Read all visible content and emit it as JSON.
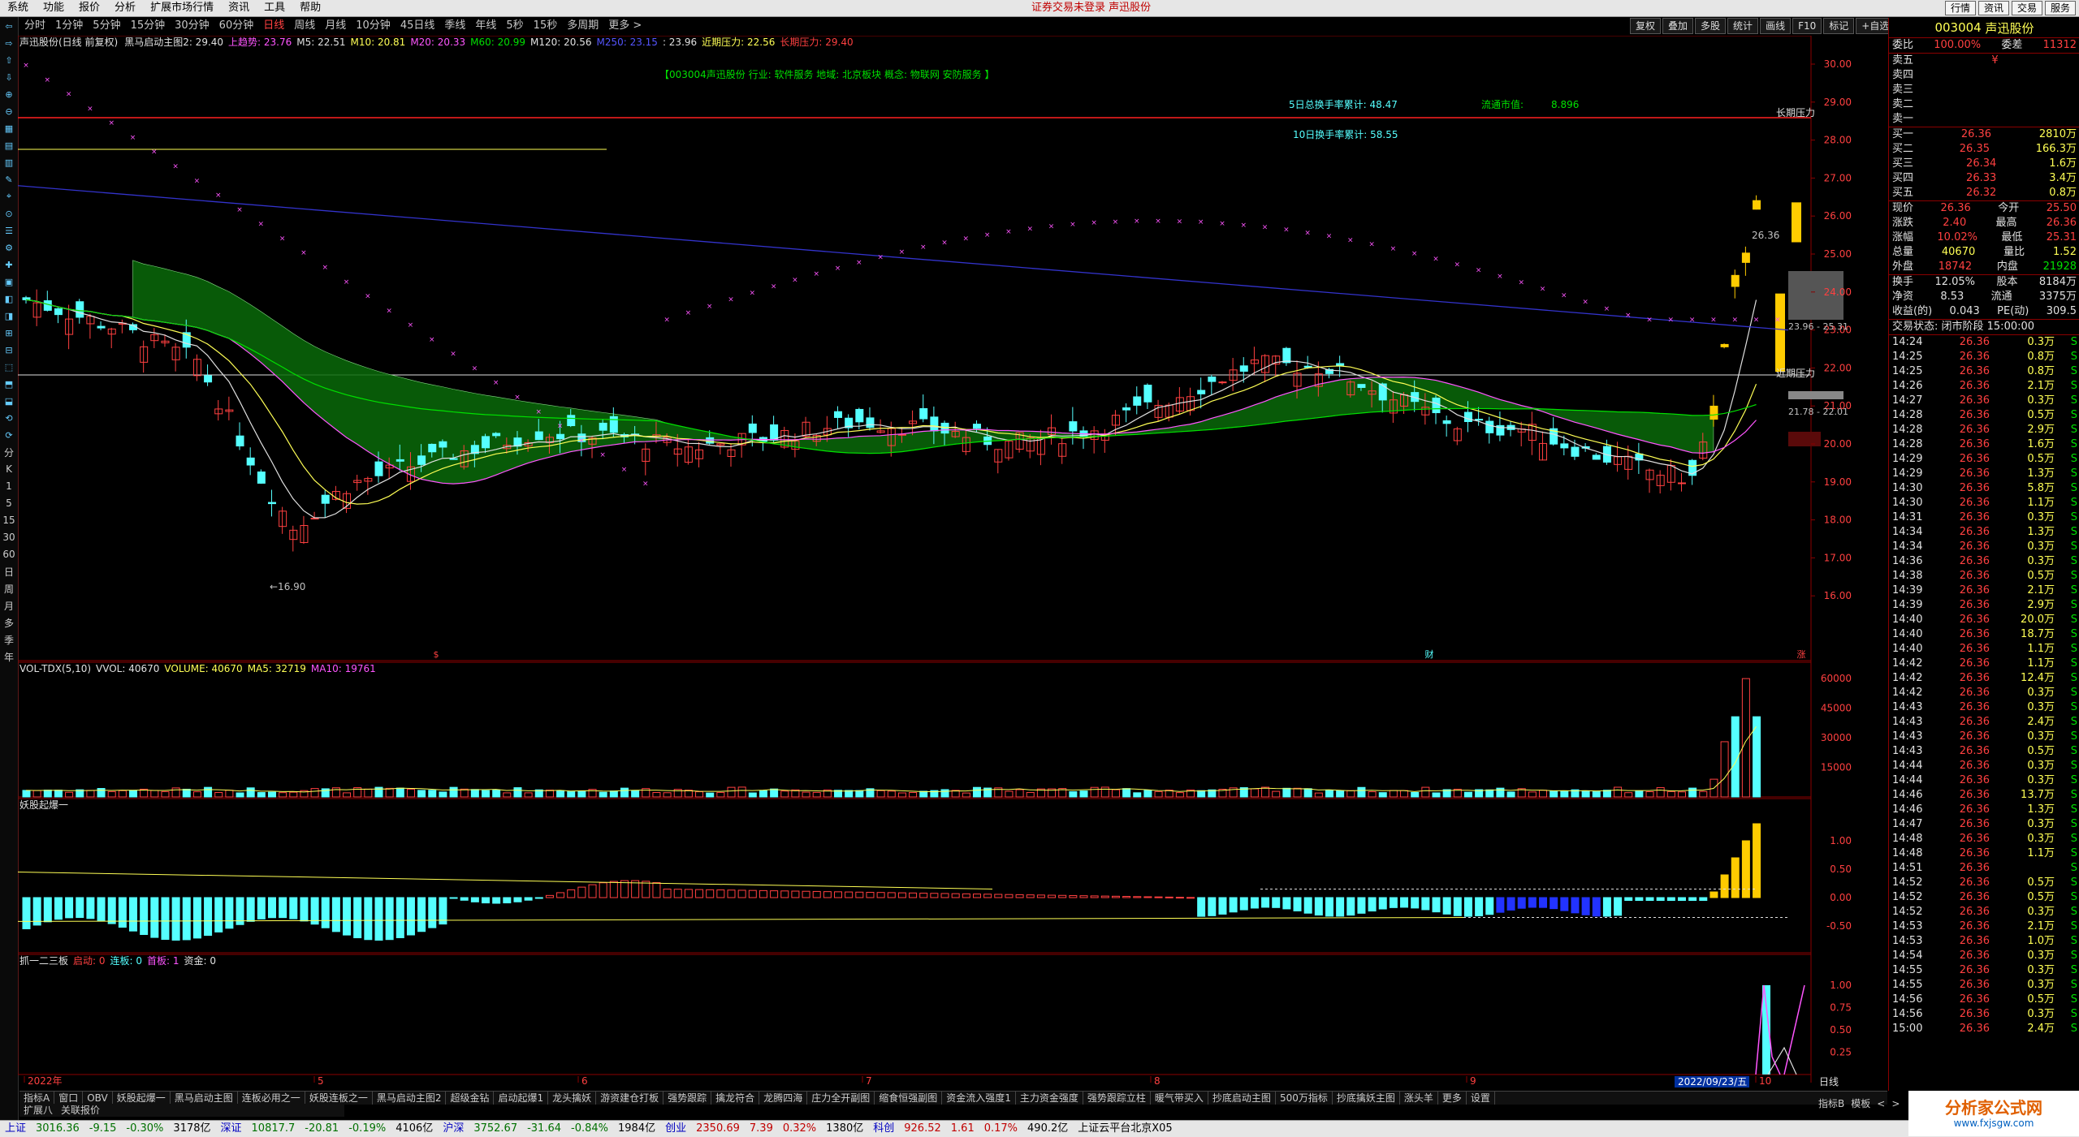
{
  "menubar": {
    "items": [
      "系统",
      "功能",
      "报价",
      "分析",
      "扩展市场行情",
      "资讯",
      "工具",
      "帮助"
    ],
    "center_text": "证券交易未登录 声迅股份",
    "right_buttons": [
      "行情",
      "资讯",
      "交易",
      "服务"
    ]
  },
  "periods": {
    "items": [
      "分时",
      "1分钟",
      "5分钟",
      "15分钟",
      "30分钟",
      "60分钟",
      "日线",
      "周线",
      "月线",
      "10分钟",
      "45日线",
      "季线",
      "年线",
      "5秒",
      "15秒",
      "多周期",
      "更多 >"
    ],
    "active": "日线"
  },
  "chart_buttons": [
    "复权",
    "叠加",
    "多股",
    "统计",
    "画线",
    "F10",
    "标记",
    "+自选",
    "返回"
  ],
  "left_tools": [
    "分",
    "K",
    "1",
    "5",
    "15",
    "30",
    "60",
    "日",
    "周",
    "月",
    "多",
    "季",
    "年"
  ],
  "main_header": {
    "title": "声迅股份(日线 前复权)",
    "indicator": "黑马启动主图2",
    "value": ": 29.40",
    "items": [
      {
        "text": "上趋势: 23.76",
        "color": "#ff55ff"
      },
      {
        "text": "M5: 22.51",
        "color": "#e0e0e0"
      },
      {
        "text": "M10: 20.81",
        "color": "#ffff55"
      },
      {
        "text": "M20: 20.33",
        "color": "#ff55ff"
      },
      {
        "text": "M60: 20.99",
        "color": "#00e000"
      },
      {
        "text": "M120: 20.56",
        "color": "#e0e0e0"
      },
      {
        "text": "M250: 23.15",
        "color": "#5555ff"
      },
      {
        "text": ": 23.96",
        "color": "#e0e0e0"
      },
      {
        "text": "近期压力: 22.56",
        "color": "#ffff55"
      },
      {
        "text": "长期压力: 29.40",
        "color": "#ff4040"
      }
    ]
  },
  "info_banner": "【003004声迅股份  行业: 软件服务  地域: 北京板块  概念: 物联网 安防服务 】",
  "stats": {
    "turnover5_label": "5日总换手率累计: 48.47",
    "float_label": "流通市值:",
    "float_value": "8.896",
    "turnover10_label": "10日换手率累计: 58.55"
  },
  "annotations": {
    "long_pressure": "长期压力",
    "near_pressure": "近期压力",
    "low_label": "←16.90",
    "high_label": "26.36",
    "range1": "23.96 - 25.31",
    "range2": "21.78 - 22.01"
  },
  "vol_header": {
    "title": "VOL-TDX(5,10)",
    "items": [
      {
        "text": "VVOL: 40670",
        "color": "#e0e0e0"
      },
      {
        "text": "VOLUME: 40670",
        "color": "#ffff55"
      },
      {
        "text": "MA5: 32719",
        "color": "#ffff55"
      },
      {
        "text": "MA10: 19761",
        "color": "#ff55ff"
      }
    ]
  },
  "ind1_header": {
    "title": "妖股起爆一"
  },
  "ind2_header": {
    "title": "抓一二三板",
    "items": [
      {
        "text": "启动: 0",
        "color": "#ff4040"
      },
      {
        "text": "连板: 0",
        "color": "#55ffff"
      },
      {
        "text": "首板: 1",
        "color": "#ff55ff"
      },
      {
        "text": "资金: 0",
        "color": "#e0e0e0"
      }
    ]
  },
  "price_axis": [
    "30.00",
    "29.00",
    "28.00",
    "27.00",
    "26.00",
    "25.00",
    "24.00",
    "23.00",
    "22.00",
    "21.00",
    "20.00",
    "19.00",
    "18.00",
    "17.00",
    "16.00"
  ],
  "vol_axis": [
    "60000",
    "45000",
    "30000",
    "15000"
  ],
  "ind1_axis": [
    "1.00",
    "0.50",
    "0.00",
    "-0.50"
  ],
  "ind2_axis": [
    "1.00",
    "0.75",
    "0.50",
    "0.25"
  ],
  "date_axis": {
    "labels": [
      "2022年",
      "5",
      "6",
      "7",
      "8",
      "9",
      "10"
    ],
    "highlight": "2022/09/23/五",
    "right": "日线"
  },
  "markers": [
    "$",
    "财",
    "涨"
  ],
  "quote": {
    "code": "003004",
    "name": "声迅股份",
    "weibi_label": "委比",
    "weibi": "100.00%",
    "weicha_label": "委差",
    "weicha": "11312",
    "asks": [
      {
        "label": "卖五",
        "price": "¥",
        "vol": ""
      },
      {
        "label": "卖四",
        "price": "",
        "vol": ""
      },
      {
        "label": "卖三",
        "price": "",
        "vol": ""
      },
      {
        "label": "卖二",
        "price": "",
        "vol": ""
      },
      {
        "label": "卖一",
        "price": "",
        "vol": ""
      }
    ],
    "bids": [
      {
        "label": "买一",
        "price": "26.36",
        "vol": "2810万"
      },
      {
        "label": "买二",
        "price": "26.35",
        "vol": "166.3万"
      },
      {
        "label": "买三",
        "price": "26.34",
        "vol": "1.6万"
      },
      {
        "label": "买四",
        "price": "26.33",
        "vol": "3.4万"
      },
      {
        "label": "买五",
        "price": "26.32",
        "vol": "0.8万"
      }
    ],
    "stats": [
      {
        "l1": "现价",
        "v1": "26.36",
        "c1": "red",
        "l2": "今开",
        "v2": "25.50",
        "c2": "red"
      },
      {
        "l1": "涨跌",
        "v1": "2.40",
        "c1": "red",
        "l2": "最高",
        "v2": "26.36",
        "c2": "red"
      },
      {
        "l1": "涨幅",
        "v1": "10.02%",
        "c1": "red",
        "l2": "最低",
        "v2": "25.31",
        "c2": "red"
      },
      {
        "l1": "总量",
        "v1": "40670",
        "c1": "yel",
        "l2": "量比",
        "v2": "1.52",
        "c2": "yel"
      },
      {
        "l1": "外盘",
        "v1": "18742",
        "c1": "red",
        "l2": "内盘",
        "v2": "21928",
        "c2": "grn"
      }
    ],
    "stats2": [
      {
        "l1": "换手",
        "v1": "12.05%",
        "c1": "wht",
        "l2": "股本",
        "v2": "8184万",
        "c2": "wht"
      },
      {
        "l1": "净资",
        "v1": "8.53",
        "c1": "wht",
        "l2": "流通",
        "v2": "3375万",
        "c2": "wht"
      },
      {
        "l1": "收益(的)",
        "v1": "0.043",
        "c1": "wht",
        "l2": "PE(动)",
        "v2": "309.5",
        "c2": "wht"
      }
    ],
    "trade_status": "交易状态: 闭市阶段 15:00:00",
    "ticks": [
      [
        "14:24",
        "26.36",
        "0.3万",
        "S"
      ],
      [
        "14:25",
        "26.36",
        "0.8万",
        "S"
      ],
      [
        "14:25",
        "26.36",
        "0.8万",
        "S"
      ],
      [
        "14:26",
        "26.36",
        "2.1万",
        "S"
      ],
      [
        "14:27",
        "26.36",
        "0.3万",
        "S"
      ],
      [
        "14:28",
        "26.36",
        "0.5万",
        "S"
      ],
      [
        "14:28",
        "26.36",
        "2.9万",
        "S"
      ],
      [
        "14:28",
        "26.36",
        "1.6万",
        "S"
      ],
      [
        "14:29",
        "26.36",
        "0.5万",
        "S"
      ],
      [
        "14:29",
        "26.36",
        "1.3万",
        "S"
      ],
      [
        "14:30",
        "26.36",
        "5.8万",
        "S"
      ],
      [
        "14:30",
        "26.36",
        "1.1万",
        "S"
      ],
      [
        "14:31",
        "26.36",
        "0.3万",
        "S"
      ],
      [
        "14:34",
        "26.36",
        "1.3万",
        "S"
      ],
      [
        "14:34",
        "26.36",
        "0.3万",
        "S"
      ],
      [
        "14:36",
        "26.36",
        "0.3万",
        "S"
      ],
      [
        "14:38",
        "26.36",
        "0.5万",
        "S"
      ],
      [
        "14:39",
        "26.36",
        "2.1万",
        "S"
      ],
      [
        "14:39",
        "26.36",
        "2.9万",
        "S"
      ],
      [
        "14:40",
        "26.36",
        "20.0万",
        "S"
      ],
      [
        "14:40",
        "26.36",
        "18.7万",
        "S"
      ],
      [
        "14:40",
        "26.36",
        "1.1万",
        "S"
      ],
      [
        "14:42",
        "26.36",
        "1.1万",
        "S"
      ],
      [
        "14:42",
        "26.36",
        "12.4万",
        "S"
      ],
      [
        "14:42",
        "26.36",
        "0.3万",
        "S"
      ],
      [
        "14:43",
        "26.36",
        "0.3万",
        "S"
      ],
      [
        "14:43",
        "26.36",
        "2.4万",
        "S"
      ],
      [
        "14:43",
        "26.36",
        "0.3万",
        "S"
      ],
      [
        "14:43",
        "26.36",
        "0.5万",
        "S"
      ],
      [
        "14:44",
        "26.36",
        "0.3万",
        "S"
      ],
      [
        "14:44",
        "26.36",
        "0.3万",
        "S"
      ],
      [
        "14:46",
        "26.36",
        "13.7万",
        "S"
      ],
      [
        "14:46",
        "26.36",
        "1.3万",
        "S"
      ],
      [
        "14:47",
        "26.36",
        "0.3万",
        "S"
      ],
      [
        "14:48",
        "26.36",
        "0.3万",
        "S"
      ],
      [
        "14:48",
        "26.36",
        "1.1万",
        "S"
      ],
      [
        "14:51",
        "26.36",
        "",
        "S"
      ],
      [
        "14:52",
        "26.36",
        "0.5万",
        "S"
      ],
      [
        "14:52",
        "26.36",
        "0.5万",
        "S"
      ],
      [
        "14:52",
        "26.36",
        "0.3万",
        "S"
      ],
      [
        "14:53",
        "26.36",
        "2.1万",
        "S"
      ],
      [
        "14:53",
        "26.36",
        "1.0万",
        "S"
      ],
      [
        "14:54",
        "26.36",
        "0.3万",
        "S"
      ],
      [
        "14:55",
        "26.36",
        "0.3万",
        "S"
      ],
      [
        "14:55",
        "26.36",
        "0.3万",
        "S"
      ],
      [
        "14:56",
        "26.36",
        "0.5万",
        "S"
      ],
      [
        "14:56",
        "26.36",
        "0.3万",
        "S"
      ],
      [
        "15:00",
        "26.36",
        "2.4万",
        "S"
      ]
    ]
  },
  "tabs": [
    "指标A",
    "窗口",
    "OBV",
    "妖股起爆一",
    "黑马启动主图",
    "连板必用之一",
    "妖股连板之一",
    "黑马启动主图2",
    "超级金钻",
    "启动起爆1",
    "龙头擒妖",
    "游资建仓打板",
    "强势跟踪",
    "擒龙符合",
    "龙腾四海",
    "庄力全开副图",
    "缩食恒强副图",
    "资金流入强度1",
    "主力资金强度",
    "强势跟踪立柱",
    "暖气带买入",
    "抄底启动主图",
    "500万指标",
    "抄底擒妖主图",
    "涨头羊",
    "更多",
    "设置"
  ],
  "tabs2": [
    "扩展八",
    "关联报价"
  ],
  "right_tabs": [
    "指标B",
    "模板",
    "<",
    ">"
  ],
  "status": [
    {
      "text": "上证",
      "cls": "sblu"
    },
    {
      "text": "3016.36",
      "cls": "sgrn"
    },
    {
      "text": "-9.15",
      "cls": "sgrn"
    },
    {
      "text": "-0.30%",
      "cls": "sgrn"
    },
    {
      "text": "3178亿",
      "cls": ""
    },
    {
      "text": "深证",
      "cls": "sblu"
    },
    {
      "text": "10817.7",
      "cls": "sgrn"
    },
    {
      "text": "-20.81",
      "cls": "sgrn"
    },
    {
      "text": "-0.19%",
      "cls": "sgrn"
    },
    {
      "text": "4106亿",
      "cls": ""
    },
    {
      "text": "沪深",
      "cls": "sblu"
    },
    {
      "text": "3752.67",
      "cls": "sgrn"
    },
    {
      "text": "-31.64",
      "cls": "sgrn"
    },
    {
      "text": "-0.84%",
      "cls": "sgrn"
    },
    {
      "text": "1984亿",
      "cls": ""
    },
    {
      "text": "创业",
      "cls": "sblu"
    },
    {
      "text": "2350.69",
      "cls": "sred"
    },
    {
      "text": "7.39",
      "cls": "sred"
    },
    {
      "text": "0.32%",
      "cls": "sred"
    },
    {
      "text": "1380亿",
      "cls": ""
    },
    {
      "text": "科创",
      "cls": "sblu"
    },
    {
      "text": "926.52",
      "cls": "sred"
    },
    {
      "text": "1.61",
      "cls": "sred"
    },
    {
      "text": "0.17%",
      "cls": "sred"
    },
    {
      "text": "490.2亿",
      "cls": ""
    },
    {
      "text": "上证云平台北京X05",
      "cls": ""
    }
  ],
  "logo": {
    "line1": "分析家公式网",
    "line2": "www.fxjsgw.com"
  },
  "colors": {
    "up": "#ff4040",
    "down": "#55ffff",
    "grid": "#8b0000",
    "cloud": "#0a6a0a",
    "ma250": "#3333cc"
  }
}
